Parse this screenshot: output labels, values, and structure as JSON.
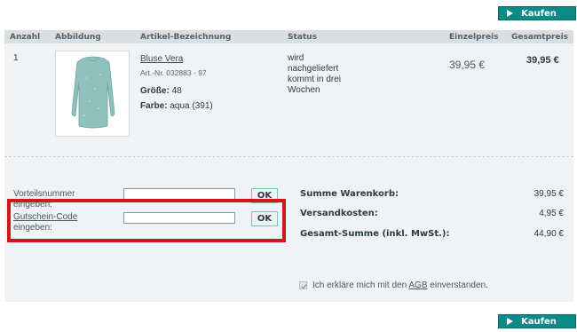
{
  "buttons": {
    "buy_label": "Kaufen"
  },
  "table": {
    "headers": {
      "count": "Anzahl",
      "image": "Abbildung",
      "name": "Artikel-Bezeichnung",
      "status": "Status",
      "unit_price": "Einzelpreis",
      "total_price": "Gesamtpreis"
    },
    "item": {
      "quantity": "1",
      "product_name": "Bluse Vera",
      "article_no": "Art.-Nr. 032883 - 97",
      "size_label": "Größe:",
      "size_value": "48",
      "color_label": "Farbe:",
      "color_value": "aqua (391)",
      "status_lines": [
        "wird",
        "nachgeliefert",
        "kommt in drei",
        "Wochen"
      ],
      "unit_price": "39,95 €",
      "total_price": "39,95 €"
    }
  },
  "codes": {
    "advantage_label_line1": "Vorteilsnummer",
    "advantage_label_line2": "eingeben:",
    "voucher_label_line1": "Gutschein-Code",
    "voucher_label_line2": "eingeben:",
    "ok_label": "OK",
    "advantage_value": "",
    "voucher_value": ""
  },
  "summary": {
    "cart_label": "Summe Warenkorb:",
    "cart_value": "39,95 €",
    "shipping_label": "Versandkosten:",
    "shipping_value": "4,95 €",
    "total_label": "Gesamt-Summe (inkl. MwSt.):",
    "total_value": "44,90 €"
  },
  "agreement": {
    "text_before": "Ich erkläre mich mit den",
    "agb_link": "AGB",
    "text_after": "einverstanden.",
    "checked": true
  },
  "colors": {
    "accent": "#0b8a86",
    "highlight": "#d4151b",
    "panel": "#f0f3f5"
  }
}
